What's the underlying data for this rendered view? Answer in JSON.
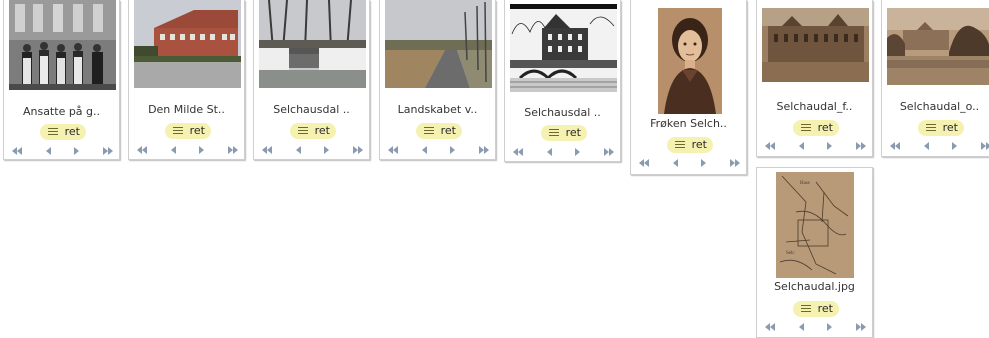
{
  "action_label": "ret",
  "items": [
    {
      "caption": "Ansatte på g.."
    },
    {
      "caption": "Den Milde St.."
    },
    {
      "caption": "Selchausdal .."
    },
    {
      "caption": "Landskabet v.."
    },
    {
      "caption": "Selchausdal .."
    },
    {
      "caption": "Frøken Selch.."
    },
    {
      "caption": "Selchaudal_f.."
    },
    {
      "caption": "Selchaudal_o.."
    },
    {
      "caption": "Selchaudal.jpg"
    }
  ]
}
